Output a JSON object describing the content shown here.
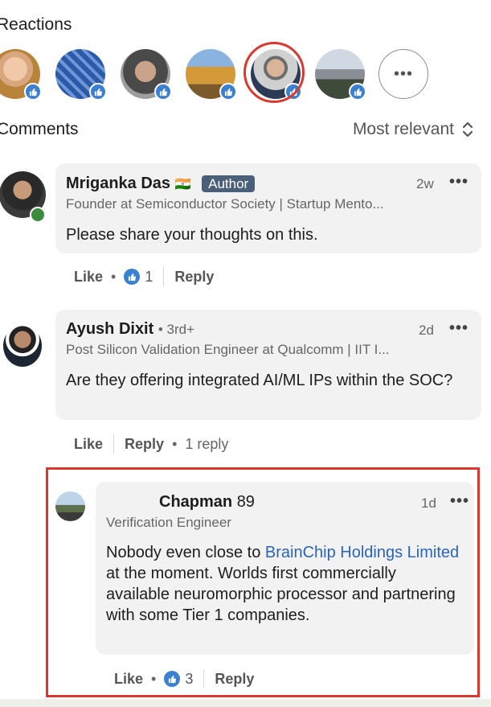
{
  "reactions": {
    "title": "Reactions",
    "more_label": "•••"
  },
  "comments": {
    "title": "Comments",
    "sort_label": "Most relevant"
  },
  "comment1": {
    "name": "Mriganka Das",
    "flag": "🇮🇳",
    "author_tag": "Author",
    "headline": "Founder at Semiconductor Society | Startup Mento...",
    "time": "2w",
    "text": "Please share your thoughts on this.",
    "like_label": "Like",
    "like_count": "1",
    "reply_label": "Reply"
  },
  "comment2": {
    "name": "Ayush Dixit",
    "degree": "• 3rd+",
    "headline": "Post Silicon Validation Engineer at Qualcomm | IIT I...",
    "time": "2d",
    "text": "Are they offering integrated AI/ML IPs within the SOC?",
    "like_label": "Like",
    "reply_label": "Reply",
    "replies": "1 reply"
  },
  "reply1": {
    "name": "Chapman",
    "name_suffix": "89",
    "headline": "Verification Engineer",
    "time": "1d",
    "text_before": "Nobody even close to ",
    "link_text": "BrainChip Holdings Limited",
    "text_after": " at the moment. Worlds first commercially available neuromorphic processor and partnering with some Tier 1 companies.",
    "like_label": "Like",
    "like_count": "3",
    "reply_label": "Reply"
  },
  "colors": {
    "accent_blue": "#3b7fd0",
    "link_blue": "#2a65b8",
    "highlight_red": "#d9392e",
    "author_tag": "#4a5f78"
  }
}
